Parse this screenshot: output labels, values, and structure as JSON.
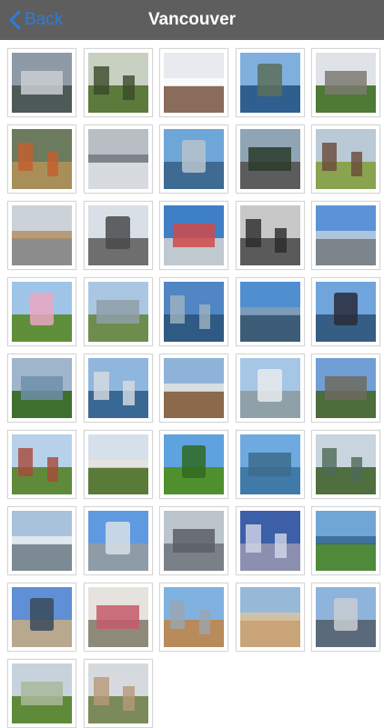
{
  "navbar": {
    "back_label": "Back",
    "title": "Vancouver"
  },
  "gallery": {
    "photos": [
      {
        "sky": "#8e9aa6",
        "ground": "#4e5a58",
        "accent": "#c9ced2"
      },
      {
        "sky": "#c8d0c2",
        "ground": "#5c7a3c",
        "accent": "#3a4a2a"
      },
      {
        "sky": "#e7eaee",
        "ground": "#8a6c5a",
        "accent": "#ffffff"
      },
      {
        "sky": "#7fb0dd",
        "ground": "#2f5f8f",
        "accent": "#5a6e5a"
      },
      {
        "sky": "#dfe3e8",
        "ground": "#4d7a35",
        "accent": "#7d7a70"
      },
      {
        "sky": "#6c7a5e",
        "ground": "#a88f5a",
        "accent": "#c75f2c"
      },
      {
        "sky": "#b9bec4",
        "ground": "#d7dbe0",
        "accent": "#6a7078"
      },
      {
        "sky": "#6fa6d8",
        "ground": "#3e6a93",
        "accent": "#b8c3cc"
      },
      {
        "sky": "#8fa5b5",
        "ground": "#5c5c5c",
        "accent": "#2a3a2a"
      },
      {
        "sky": "#b9c9d5",
        "ground": "#8aa34e",
        "accent": "#6a4a3a"
      },
      {
        "sky": "#cbd2d8",
        "ground": "#8d8d8d",
        "accent": "#b28a5a"
      },
      {
        "sky": "#d8dfe6",
        "ground": "#6e6e6e",
        "accent": "#4a4a4a"
      },
      {
        "sky": "#3f7fc6",
        "ground": "#c0c8d0",
        "accent": "#d04a4a"
      },
      {
        "sky": "#c8c8c8",
        "ground": "#5a5a5a",
        "accent": "#2a2a2a"
      },
      {
        "sky": "#5c92d6",
        "ground": "#7c848c",
        "accent": "#c7d6e0"
      },
      {
        "sky": "#9ec5e8",
        "ground": "#5f8f3a",
        "accent": "#e9a6c2"
      },
      {
        "sky": "#a9c7e3",
        "ground": "#6d8d4e",
        "accent": "#8e9fa8"
      },
      {
        "sky": "#4f86c3",
        "ground": "#2e5a84",
        "accent": "#9fb3c2"
      },
      {
        "sky": "#4f8fd0",
        "ground": "#3d5c78",
        "accent": "#8aa0b3"
      },
      {
        "sky": "#6fa4dc",
        "ground": "#365d83",
        "accent": "#2a2a3a"
      },
      {
        "sky": "#9fb5cc",
        "ground": "#3f6f2e",
        "accent": "#6f8fa8"
      },
      {
        "sky": "#8fb7de",
        "ground": "#3a6894",
        "accent": "#d8dde2"
      },
      {
        "sky": "#8fb3d8",
        "ground": "#8a6a4a",
        "accent": "#f0ece6"
      },
      {
        "sky": "#a6c6e6",
        "ground": "#90a0a8",
        "accent": "#e8eaec"
      },
      {
        "sky": "#6f9fd4",
        "ground": "#4c6c3c",
        "accent": "#6e6a5e"
      },
      {
        "sky": "#b7d1ea",
        "ground": "#5f8a3a",
        "accent": "#a84a3a"
      },
      {
        "sky": "#d6e0ea",
        "ground": "#5a7a3a",
        "accent": "#e8e4de"
      },
      {
        "sky": "#5fa2e0",
        "ground": "#4f8f2e",
        "accent": "#2f6a20"
      },
      {
        "sky": "#6ea9e0",
        "ground": "#3f7aa8",
        "accent": "#3c6c8c"
      },
      {
        "sky": "#c8d4de",
        "ground": "#4f6f3f",
        "accent": "#4f6a58"
      },
      {
        "sky": "#a9c2dc",
        "ground": "#7c8a94",
        "accent": "#f2f4f6"
      },
      {
        "sky": "#5f9ae0",
        "ground": "#8e9ca8",
        "accent": "#d8e0e8"
      },
      {
        "sky": "#bcc4cc",
        "ground": "#7a8088",
        "accent": "#5a5f66"
      },
      {
        "sky": "#3c5fa8",
        "ground": "#8c8fb0",
        "accent": "#d4d8ea"
      },
      {
        "sky": "#6fa6d6",
        "ground": "#4f8a3a",
        "accent": "#2f5f8a"
      },
      {
        "sky": "#5f8fd4",
        "ground": "#b8a88e",
        "accent": "#3a4a5a"
      },
      {
        "sky": "#e6e2de",
        "ground": "#8e8a7a",
        "accent": "#c45a6a"
      },
      {
        "sky": "#7fb2e0",
        "ground": "#b98a5a",
        "accent": "#9aa6b0"
      },
      {
        "sky": "#96b9d8",
        "ground": "#c9a478",
        "accent": "#e0c49a"
      },
      {
        "sky": "#8fb4dc",
        "ground": "#5a6a7a",
        "accent": "#c8ccd2"
      },
      {
        "sky": "#c6d2dc",
        "ground": "#5f8a3a",
        "accent": "#a8b89a"
      },
      {
        "sky": "#d6dade",
        "ground": "#7a8a5a",
        "accent": "#b89a7a"
      }
    ]
  }
}
